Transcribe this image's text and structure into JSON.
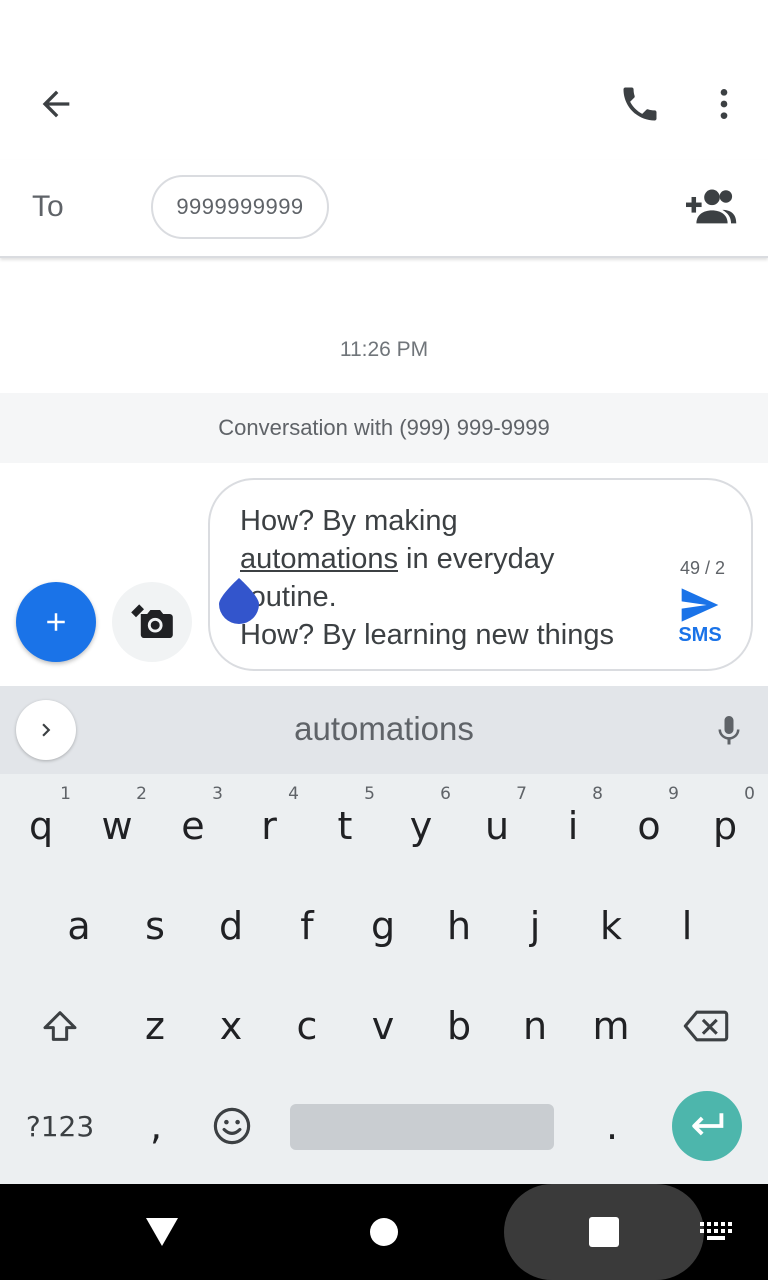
{
  "header": {
    "back_icon": "arrow-back-icon",
    "call_icon": "phone-icon",
    "more_icon": "more-vert-icon"
  },
  "to_row": {
    "label": "To",
    "recipient": "9999999999",
    "add_icon": "add-person-icon"
  },
  "conversation": {
    "timestamp": "11:26 PM",
    "banner": "Conversation with (999) 999-9999"
  },
  "compose": {
    "line1": "How? By making",
    "line2_word": "automations",
    "line2_rest": " in everyday",
    "line3": "routine.",
    "line4": "How? By learning new things",
    "char_count": "49 / 2",
    "send_label": "SMS",
    "accent": "#1a73e8"
  },
  "keyboard": {
    "suggestion": "automations",
    "row1": [
      {
        "k": "q",
        "h": "1"
      },
      {
        "k": "w",
        "h": "2"
      },
      {
        "k": "e",
        "h": "3"
      },
      {
        "k": "r",
        "h": "4"
      },
      {
        "k": "t",
        "h": "5"
      },
      {
        "k": "y",
        "h": "6"
      },
      {
        "k": "u",
        "h": "7"
      },
      {
        "k": "i",
        "h": "8"
      },
      {
        "k": "o",
        "h": "9"
      },
      {
        "k": "p",
        "h": "0"
      }
    ],
    "row2": [
      "a",
      "s",
      "d",
      "f",
      "g",
      "h",
      "j",
      "k",
      "l"
    ],
    "row3": [
      "z",
      "x",
      "c",
      "v",
      "b",
      "n",
      "m"
    ],
    "symbols_label": "?123",
    "comma": ",",
    "period": ".",
    "enter_color": "#4db6ac"
  }
}
